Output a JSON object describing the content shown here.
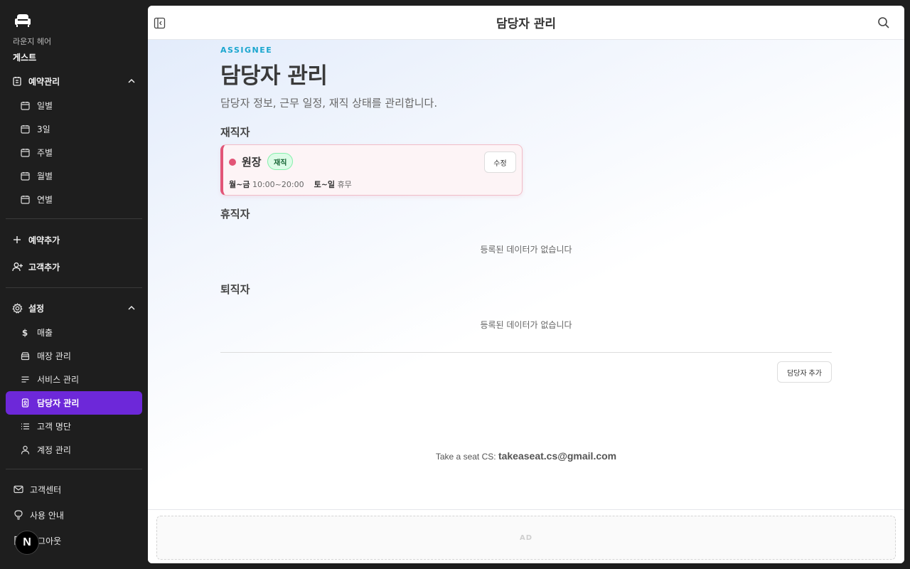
{
  "brand": {
    "shop": "라운지 헤어",
    "user": "게스트",
    "logo_icon": "sofa-icon"
  },
  "nav": {
    "reservations": {
      "label": "예약관리",
      "items": [
        {
          "label": "일별",
          "icon": "calendar-icon"
        },
        {
          "label": "3일",
          "icon": "calendar-icon"
        },
        {
          "label": "주별",
          "icon": "calendar-icon"
        },
        {
          "label": "월별",
          "icon": "calendar-icon"
        },
        {
          "label": "연별",
          "icon": "calendar-icon"
        }
      ]
    },
    "actions": [
      {
        "label": "예약추가",
        "icon": "plus-icon"
      },
      {
        "label": "고객추가",
        "icon": "user-plus-icon"
      }
    ],
    "settings": {
      "label": "설정",
      "items": [
        {
          "label": "매출",
          "icon": "dollar-icon"
        },
        {
          "label": "매장 관리",
          "icon": "store-icon"
        },
        {
          "label": "서비스 관리",
          "icon": "list-icon"
        },
        {
          "label": "담당자 관리",
          "icon": "badge-icon",
          "active": true
        },
        {
          "label": "고객 명단",
          "icon": "list-bullets-icon"
        },
        {
          "label": "계정 관리",
          "icon": "user-icon"
        }
      ]
    },
    "footer": [
      {
        "label": "고객센터",
        "icon": "mail-icon"
      },
      {
        "label": "사용 안내",
        "icon": "lightbulb-icon"
      },
      {
        "label": "로그아웃",
        "icon": "logout-icon"
      }
    ],
    "badge_letter": "N"
  },
  "header": {
    "title": "담당자 관리"
  },
  "page": {
    "eyebrow": "ASSIGNEE",
    "title": "담당자 관리",
    "description": "담당자 정보, 근무 일정, 재직 상태를 관리합니다.",
    "sections": {
      "employed": "재직자",
      "leave": "휴직자",
      "retired": "퇴직자"
    },
    "empty_text": "등록된 데이터가 없습니다",
    "card": {
      "name": "원장",
      "status": "재직",
      "edit_label": "수정",
      "weekday_label": "월~금",
      "weekday_hours": "10:00~20:00",
      "weekend_label": "토~일",
      "weekend_hours": "휴무",
      "accent_color": "#e25577"
    },
    "add_button": "담당자 추가"
  },
  "footer": {
    "cs_label": "Take a seat CS:",
    "cs_email": "takeaseat.cs@gmail.com"
  },
  "ad": {
    "label": "AD"
  },
  "colors": {
    "active_nav": "#6d28d9",
    "eyebrow": "#1aa6cf"
  }
}
